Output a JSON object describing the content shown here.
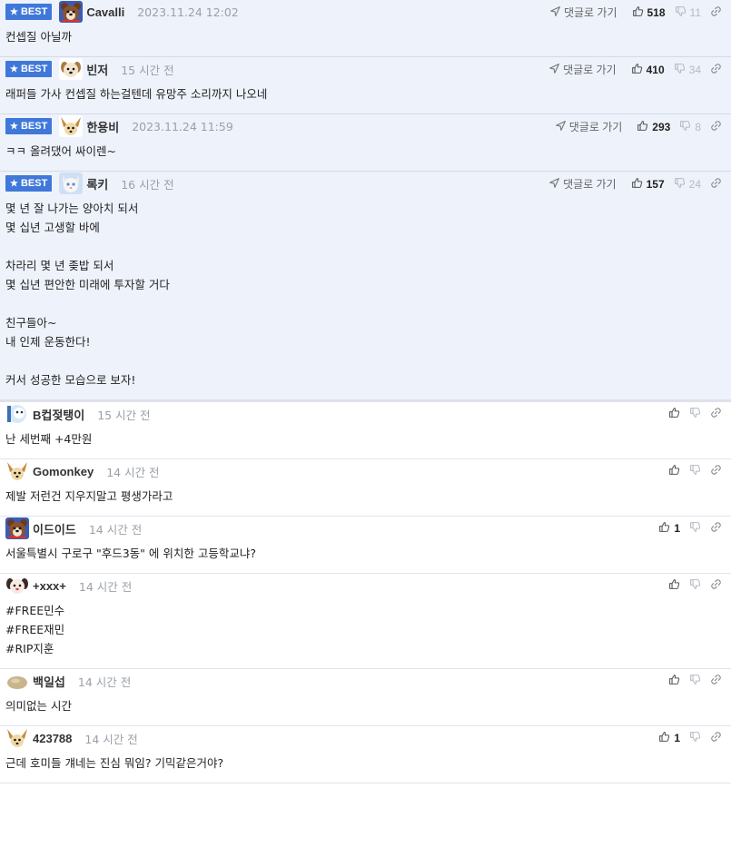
{
  "ui": {
    "best_label": "BEST",
    "reply_label": "댓글로 가기"
  },
  "best_comments": [
    {
      "nick": "Cavalli",
      "time": "2023.11.24 12:02",
      "up": "518",
      "down": "11",
      "avatar": "bear",
      "lines": [
        "컨셉질 아닐까"
      ]
    },
    {
      "nick": "빈저",
      "time": "15 시간 전",
      "up": "410",
      "down": "34",
      "avatar": "puppy",
      "lines": [
        "래퍼들 가사 컨셉질 하는걸텐데 유망주 소리까지 나오네"
      ]
    },
    {
      "nick": "한용비",
      "time": "2023.11.24 11:59",
      "up": "293",
      "down": "8",
      "avatar": "fennec",
      "lines": [
        "ㅋㅋ 올려댔어 싸이렌~"
      ]
    },
    {
      "nick": "록키",
      "time": "16 시간 전",
      "up": "157",
      "down": "24",
      "avatar": "cat",
      "lines": [
        "몇 년 잘 나가는 양아치 되서",
        "몇 십년 고생할 바에",
        "",
        "차라리 몇 년 좆밥 되서",
        "몇 십년 편안한 미래에 투자할 거다",
        "",
        "친구들아~",
        "내 인제 운동한다!",
        "",
        "커서 성공한 모습으로 보자!"
      ]
    }
  ],
  "comments": [
    {
      "nick": "B컵젖탱이",
      "time": "15 시간 전",
      "up": "",
      "avatar": "blue",
      "lines": [
        "난 세번째 +4만원"
      ]
    },
    {
      "nick": "Gomonkey",
      "time": "14 시간 전",
      "up": "",
      "avatar": "fennec",
      "lines": [
        "제발 저런건 지우지말고 평생가라고"
      ]
    },
    {
      "nick": "이드이드",
      "time": "14 시간 전",
      "up": "1",
      "avatar": "bear",
      "lines": [
        "서울특별시 구로구 \"후드3동\" 에 위치한 고등학교냐?"
      ]
    },
    {
      "nick": "+xxx+",
      "time": "14 시간 전",
      "up": "",
      "avatar": "dog",
      "lines": [
        "#FREE민수",
        "#FREE재민",
        "#RIP지훈"
      ]
    },
    {
      "nick": "백일섭",
      "time": "14 시간 전",
      "up": "",
      "avatar": "potato",
      "lines": [
        "의미없는 시간"
      ]
    },
    {
      "nick": "423788",
      "time": "14 시간 전",
      "up": "1",
      "avatar": "fennec",
      "lines": [
        "근데 호미들 걔네는 진심 뭐임? 기믹같은거야?"
      ]
    }
  ],
  "colors": {
    "best_badge": "#3f78d9",
    "best_bg": "#eef2fb",
    "time_text": "#9aa0a8"
  },
  "icons": [
    "star-icon",
    "reply-arrow-icon",
    "thumbs-up-icon",
    "thumbs-down-icon",
    "link-icon"
  ]
}
